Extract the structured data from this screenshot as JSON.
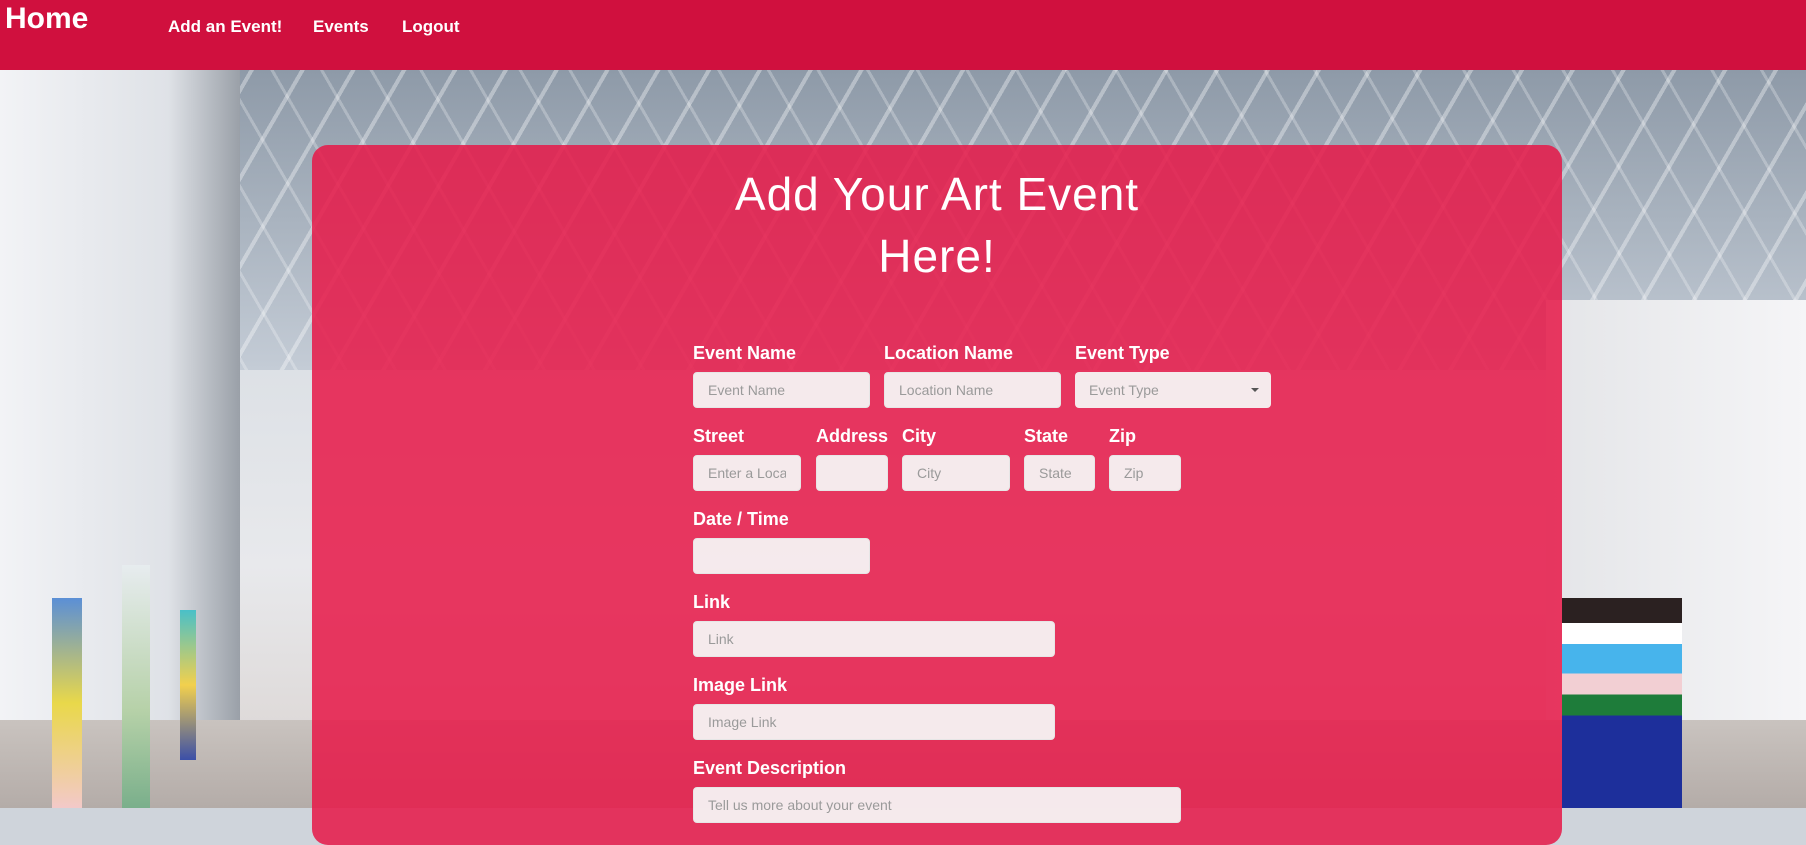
{
  "navbar": {
    "brand": "Home",
    "links": [
      "Add an Event!",
      "Events",
      "Logout"
    ]
  },
  "form": {
    "title_line1": "Add Your Art Event",
    "title_line2": "Here!",
    "event_name": {
      "label": "Event Name",
      "placeholder": "Event Name"
    },
    "location_name": {
      "label": "Location Name",
      "placeholder": "Location Name"
    },
    "event_type": {
      "label": "Event Type",
      "selected": "Event Type"
    },
    "street": {
      "label": "Street",
      "placeholder": "Enter a Locat"
    },
    "address": {
      "label": "Address",
      "placeholder": ""
    },
    "city": {
      "label": "City",
      "placeholder": "City"
    },
    "state": {
      "label": "State",
      "placeholder": "State"
    },
    "zip": {
      "label": "Zip",
      "placeholder": "Zip"
    },
    "datetime": {
      "label": "Date / Time",
      "placeholder": ""
    },
    "link": {
      "label": "Link",
      "placeholder": "Link"
    },
    "image_link": {
      "label": "Image Link",
      "placeholder": "Image Link"
    },
    "description": {
      "label": "Event Description",
      "placeholder": "Tell us more about your event"
    }
  },
  "colors": {
    "navbar": "#d0103e",
    "card": "#e61848"
  }
}
